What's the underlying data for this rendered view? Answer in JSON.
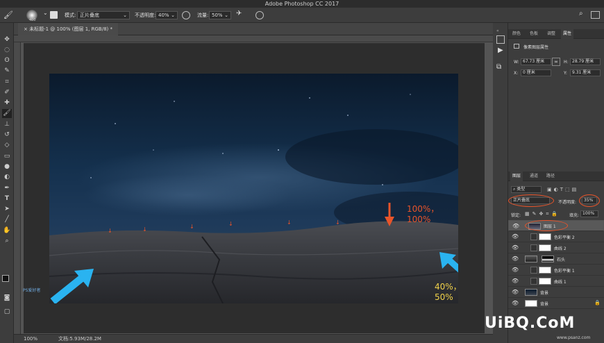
{
  "app": {
    "title": "Adobe Photoshop CC 2017"
  },
  "options": {
    "brush_size": "400",
    "mode_label": "模式:",
    "mode_value": "正片叠底",
    "opacity_label": "不透明度:",
    "opacity_value": "40%",
    "flow_label": "流量:",
    "flow_value": "50%"
  },
  "document": {
    "tab_title": "未标题-1 @ 100% (图层 1, RGB/8) *",
    "zoom": "100%",
    "doc_size": "文档:5.93M/28.2M"
  },
  "properties": {
    "tabs": [
      "颜色",
      "色板",
      "调整",
      "属性"
    ],
    "header": "像素图层属性",
    "w_label": "W:",
    "w_value": "67.73 厘米",
    "h_label": "H:",
    "h_value": "28.79 厘米",
    "x_label": "X:",
    "x_value": "0 厘米",
    "y_label": "Y:",
    "y_value": "9.31 厘米"
  },
  "layers_panel": {
    "tabs": [
      "图层",
      "通道",
      "路径"
    ],
    "filter_kind": "类型",
    "blend_mode": "正片叠底",
    "opacity_label": "不透明度:",
    "opacity_value": "35%",
    "lock_label": "锁定:",
    "fill_label": "填充:",
    "fill_value": "100%",
    "layers": [
      {
        "name": "图层 1"
      },
      {
        "name": "色彩平衡 2"
      },
      {
        "name": "曲线 2"
      },
      {
        "name": "石头"
      },
      {
        "name": "色彩平衡 1"
      },
      {
        "name": "曲线 1"
      },
      {
        "name": "背景"
      },
      {
        "name": "背景"
      }
    ]
  },
  "annotations": {
    "top_label": "100%，100%",
    "bottom_label": "40%，50%",
    "colors": {
      "orange": "#e8542a",
      "yellow": "#f1d24a",
      "blue": "#2ab3f0"
    }
  },
  "watermark": {
    "brand": "UiBQ.CoM",
    "site": "www.psanz.com",
    "small_logo": "PS爱好者"
  },
  "toolbar": {
    "icons": [
      "move-icon",
      "marquee-icon",
      "lasso-icon",
      "quick-select-icon",
      "crop-icon",
      "eyedropper-icon",
      "healing-icon",
      "brush-icon",
      "stamp-icon",
      "history-brush-icon",
      "eraser-icon",
      "gradient-icon",
      "blur-icon",
      "dodge-icon",
      "pen-icon",
      "type-icon",
      "path-select-icon",
      "shape-icon",
      "hand-icon",
      "zoom-icon"
    ]
  }
}
